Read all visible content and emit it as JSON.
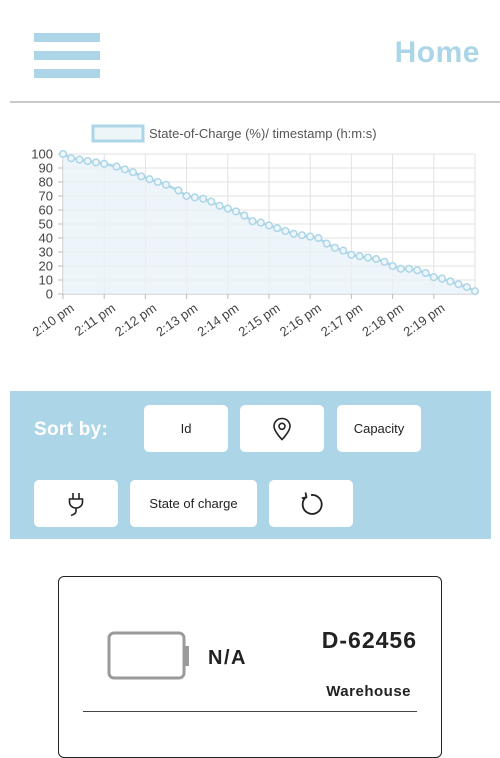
{
  "header": {
    "title": "Home",
    "menu_icon": "hamburger-menu-icon",
    "accent_color": "#acd6e7"
  },
  "chart_data": {
    "type": "line",
    "legend": "State-of-Charge (%)/ timestamp (h:m:s)",
    "legend_position": "top",
    "grid": true,
    "ylim": [
      0,
      100
    ],
    "yticks": [
      "0",
      "10",
      "20",
      "30",
      "40",
      "50",
      "60",
      "70",
      "80",
      "90",
      "100"
    ],
    "xticks": [
      "2:10 pm",
      "2:11 pm",
      "2:12 pm",
      "2:13 pm",
      "2:14 pm",
      "2:15 pm",
      "2:16 pm",
      "2:17 pm",
      "2:18 pm",
      "2:19 pm"
    ],
    "series": [
      {
        "color": "#acd6e7",
        "x": [
          0.0,
          0.2,
          0.4,
          0.6,
          0.8,
          1.0,
          1.3,
          1.5,
          1.7,
          1.9,
          2.1,
          2.3,
          2.5,
          2.8,
          3.0,
          3.2,
          3.4,
          3.6,
          3.8,
          4.0,
          4.2,
          4.4,
          4.6,
          4.8,
          5.0,
          5.2,
          5.4,
          5.6,
          5.8,
          6.0,
          6.2,
          6.4,
          6.6,
          6.8,
          7.0,
          7.2,
          7.4,
          7.6,
          7.8,
          8.0,
          8.2,
          8.4,
          8.6,
          8.8,
          9.0,
          9.2,
          9.4,
          9.6,
          9.8,
          10.0
        ],
        "y": [
          100,
          97,
          96,
          95,
          94,
          93,
          91,
          89,
          87,
          84,
          82,
          80,
          78,
          74,
          70,
          69,
          68,
          66,
          63,
          61,
          59,
          56,
          52,
          51,
          49,
          47,
          45,
          43,
          42,
          41,
          40,
          36,
          33,
          31,
          28,
          27,
          26,
          25,
          23,
          20,
          18,
          18,
          17,
          15,
          12,
          11,
          9,
          7,
          5,
          2
        ]
      }
    ]
  },
  "sort": {
    "label": "Sort by:",
    "buttons": [
      {
        "label": "Id"
      },
      {
        "icon": "location-pin-icon"
      },
      {
        "label": "Capacity"
      },
      {
        "icon": "plug-icon"
      },
      {
        "label": "State of charge"
      },
      {
        "icon": "refresh-icon"
      }
    ]
  },
  "card": {
    "icon": "battery-empty-icon",
    "charge": "N/A",
    "device_id": "D-62456",
    "location": "Warehouse"
  }
}
